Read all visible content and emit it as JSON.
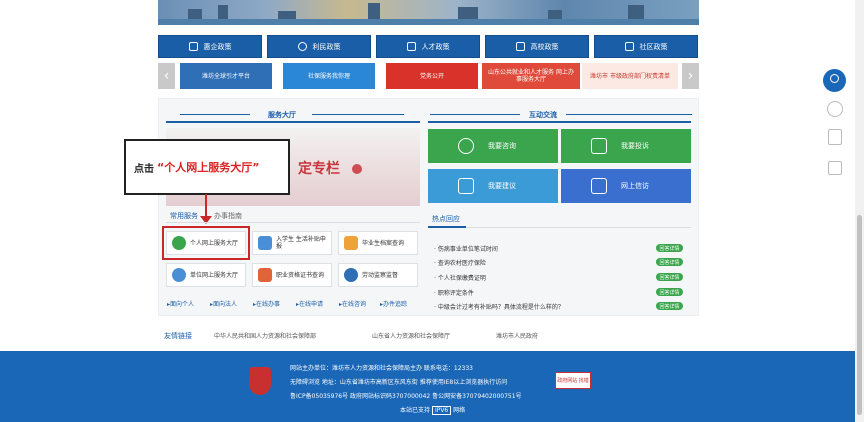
{
  "policy_buttons": [
    {
      "label": "惠企政策",
      "icon": "building-icon"
    },
    {
      "label": "利民政策",
      "icon": "people-icon"
    },
    {
      "label": "人才政策",
      "icon": "talent-icon"
    },
    {
      "label": "高校政策",
      "icon": "university-icon"
    },
    {
      "label": "社区政策",
      "icon": "community-icon"
    }
  ],
  "carousel": [
    {
      "label": "潍坊全球引才平台",
      "color": "#2f6fb5"
    },
    {
      "label": "社保服务我你理",
      "color": "#2a86d6"
    },
    {
      "label": "党务公开",
      "color": "#d8322b"
    },
    {
      "label": "山东公共就业和人才服务 网上办事服务大厅",
      "color": "#e04a3a"
    },
    {
      "label": "潍坊市 市级政府部门权责清单",
      "color": "#c0392b"
    }
  ],
  "service_hall": {
    "title": "服务大厅",
    "tabs": [
      "常用服务",
      "办事指南"
    ],
    "annotation_prefix": "点击",
    "annotation_text": "“个人网上服务大厅”",
    "banner_text": "定专栏",
    "services": [
      {
        "label": "个人网上服务大厅",
        "color": "#3aa54d"
      },
      {
        "label": "入学生 生活补贴申报",
        "color": "#4a8fd6"
      },
      {
        "label": "毕业生档案查询",
        "color": "#f0a23a"
      },
      {
        "label": "单位网上服务大厅",
        "color": "#4a8fd6"
      },
      {
        "label": "职业资格证书查询",
        "color": "#e0633a"
      },
      {
        "label": "劳动监察监督",
        "color": "#2f6fb5"
      }
    ],
    "bottom_links": [
      "面向个人",
      "面向法人",
      "在线办事",
      "在线申请",
      "在线咨询",
      "办件追踪"
    ]
  },
  "interaction": {
    "title": "互动交流",
    "tiles": [
      {
        "label": "我要咨询",
        "color": "#3aa54d"
      },
      {
        "label": "我要投诉",
        "color": "#3aa54d"
      },
      {
        "label": "我要建议",
        "color": "#3a9bd6"
      },
      {
        "label": "网上信访",
        "color": "#3a6fd0"
      }
    ]
  },
  "hot_questions": {
    "title": "热点回应",
    "items": [
      {
        "text": "伤病事业单位笔试时间",
        "badge": "回答详情"
      },
      {
        "text": "查询农村医疗保险",
        "badge": "回答详情"
      },
      {
        "text": "个人社保缴费证明",
        "badge": "回答详情"
      },
      {
        "text": "职称评定条件",
        "badge": "回答详情"
      },
      {
        "text": "中级会计过考有补贴吗？具体流程是什么样的？",
        "badge": "回答详情"
      }
    ]
  },
  "friend_links": {
    "label": "友情链接",
    "items": [
      "中华人民共和国人力资源和社会保障部",
      "山东省人力资源和社会保障厅",
      "潍坊市人民政府"
    ]
  },
  "footer": {
    "line1": "网站主办单位：潍坊市人力资源和社会保障局主办  联系电话：12333",
    "line2": "无障碍浏览   地址：山东省潍坊市高新区东风东街   推荐使用IE8以上浏览器执行访问",
    "line3": "鲁ICP备05035976号 政府网站标识码3707000042 鲁公网安备37079402000751号",
    "line4_prefix": "本站已支持",
    "line4_badge": "IPV6",
    "line4_suffix": "网络",
    "gov_badge": "政府网站 找错"
  }
}
